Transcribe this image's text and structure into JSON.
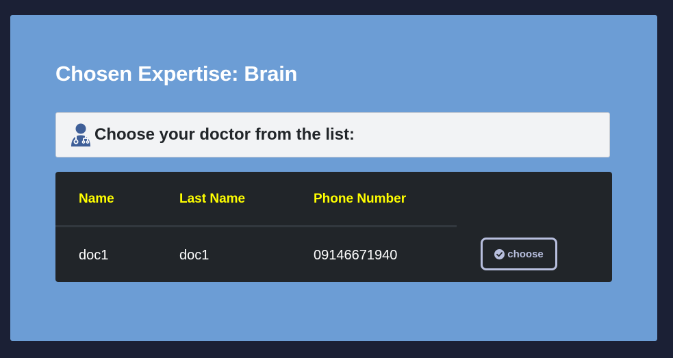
{
  "page": {
    "title_prefix": "Chosen Expertise: ",
    "title_value": "Brain",
    "instruction": "Choose your doctor from the list:"
  },
  "table": {
    "headers": [
      "Name",
      "Last Name",
      "Phone Number"
    ],
    "rows": [
      {
        "name": "doc1",
        "last_name": "doc1",
        "phone": "09146671940",
        "action_label": "choose"
      }
    ]
  },
  "icons": {
    "instruction_icon": "user-doctor-icon",
    "action_icon": "check-circle-icon"
  },
  "colors": {
    "page_background": "#1b2035",
    "panel_background": "#6c9dd5",
    "table_background": "#212529",
    "header_text": "#ffff00",
    "button_border": "#b8bfde"
  }
}
